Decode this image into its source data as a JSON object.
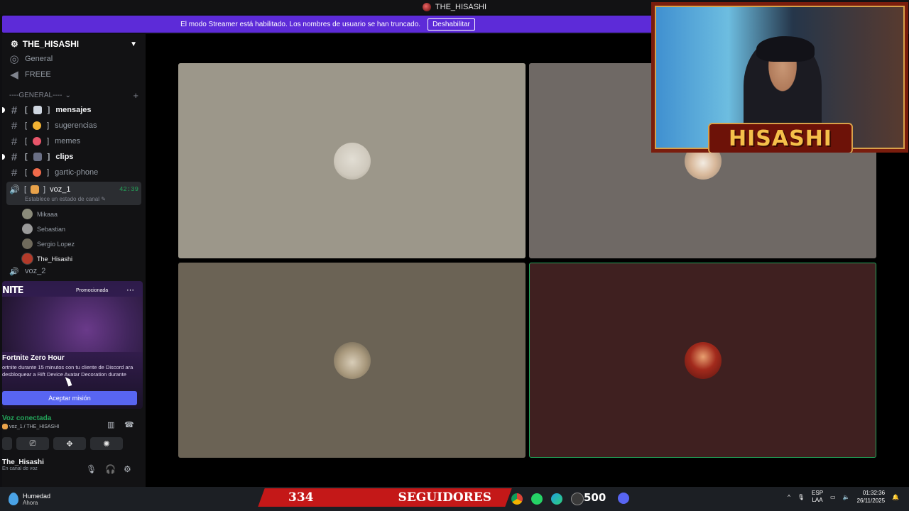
{
  "window_title": "THE_HISASHI",
  "banner": {
    "text": "El modo Streamer está habilitado. Los nombres de usuario se han truncado.",
    "button": "Deshabilitar"
  },
  "server": {
    "name": "THE_HISASHI",
    "top_channels": [
      "General",
      "FREEE"
    ],
    "category": "----GENERAL----",
    "channels": [
      {
        "name": "mensajes",
        "unread": true
      },
      {
        "name": "sugerencias",
        "unread": false
      },
      {
        "name": "memes",
        "unread": false
      },
      {
        "name": "clips",
        "unread": true
      },
      {
        "name": "gartic-phone",
        "unread": false
      }
    ],
    "voice_channel": {
      "name": "voz_1",
      "timer": "42:39",
      "status": "Establece un estado de canal",
      "users": [
        "Mikaaa",
        "Sebastian",
        "Sergio Lopez",
        "The_Hisashi"
      ]
    },
    "next_voice": "voz_2"
  },
  "promo": {
    "brand": "NITE",
    "tag": "Promocionada",
    "title": "Fortnite Zero Hour",
    "desc": "ortnite durante 15 minutos con tu cliente de Discord ara desbloquear a Rift Device Avatar Decoration durante",
    "accept": "Aceptar misión"
  },
  "voice_status": {
    "label": "Voz conectada",
    "channel": "voz_1 / THE_HISASHI"
  },
  "user_panel": {
    "name": "The_Hisashi",
    "status": "En canal de voz"
  },
  "webcam": {
    "nameplate": "HISASHI"
  },
  "taskbar": {
    "weather_title": "Humedad",
    "weather_sub": "Ahora",
    "followers_count": "334",
    "followers_label": "SEGUIDORES",
    "score": "500",
    "lang_top": "ESP",
    "lang_bottom": "LAA",
    "time": "01:32:36",
    "date": "26/11/2025"
  },
  "colors": {
    "accent": "#5865f2",
    "banner": "#5d2bd8",
    "speaking": "#23a55a",
    "followers_bar": "#c41818"
  }
}
